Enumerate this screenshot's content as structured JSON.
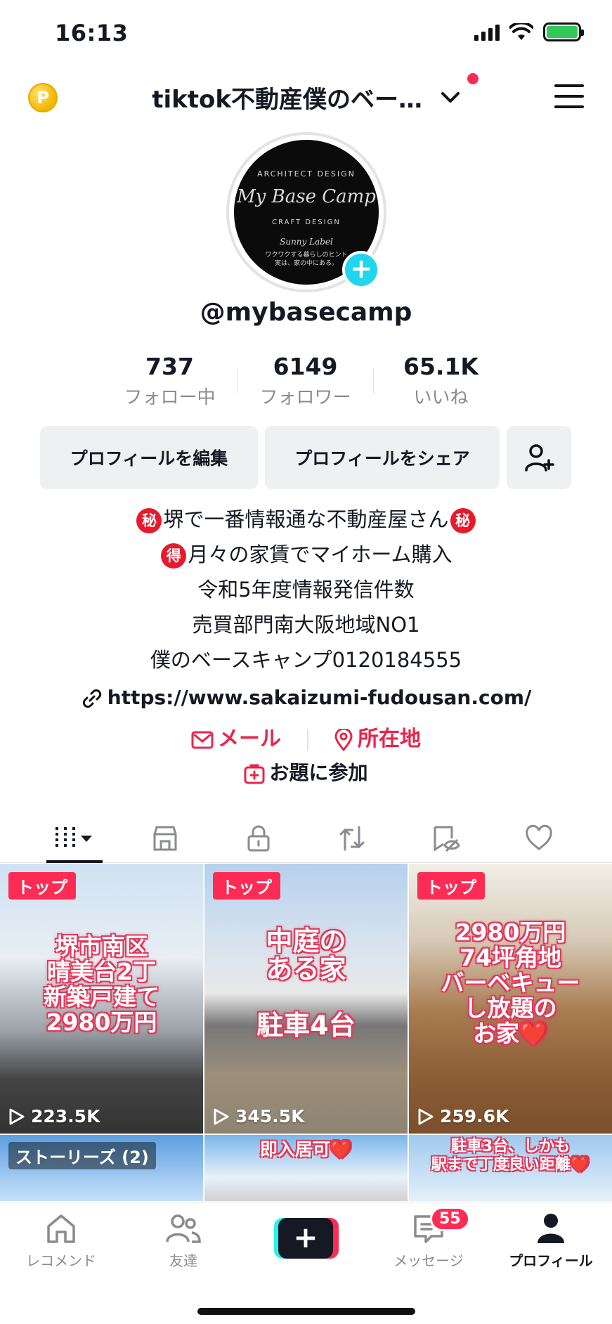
{
  "status_bar": {
    "time": "16:13"
  },
  "header": {
    "account_name": "tiktok不動産僕のベー…",
    "coin_label": "P"
  },
  "profile": {
    "avatar": {
      "line1": "ARCHITECT DESIGN",
      "line2": "My Base Camp",
      "line3": "CRAFT DESIGN",
      "line4": "Sunny Label",
      "line5": "ワクワクする暮らしのヒント\n実は、家の中にある。"
    },
    "username": "@mybasecamp",
    "stats": [
      {
        "value": "737",
        "label": "フォロー中"
      },
      {
        "value": "6149",
        "label": "フォロワー"
      },
      {
        "value": "65.1K",
        "label": "いいね"
      }
    ],
    "buttons": {
      "edit": "プロフィールを編集",
      "share": "プロフィールをシェア"
    },
    "bio": {
      "line1_badge": "秘",
      "line1_text": "堺で一番情報通な不動産屋さん",
      "line2_badge": "得",
      "line2_text": "月々の家賃でマイホーム購入",
      "line3": "令和5年度情報発信件数",
      "line4": "売買部門南大阪地域NO1",
      "line5": "僕のベースキャンプ0120184555"
    },
    "link": "https://www.sakaizumi-fudousan.com/",
    "contacts": {
      "mail": "メール",
      "location": "所在地"
    },
    "topic": "お題に参加"
  },
  "videos": [
    {
      "pin": "トップ",
      "overlay": "堺市南区\n晴美台2丁\n新築戸建て\n2980万円",
      "views": "223.5K"
    },
    {
      "pin": "トップ",
      "overlay": "中庭の\nある家\n\n駐車4台",
      "views": "345.5K"
    },
    {
      "pin": "トップ",
      "overlay": "2980万円\n74坪角地\nバーベキュー\nし放題の\nお家❤️",
      "views": "259.6K"
    },
    {
      "stories": "ストーリーズ (2)"
    },
    {
      "caption": "即入居可❤️"
    },
    {
      "caption": "駐車3台、しかも\n駅まで丁度良い距離❤️"
    }
  ],
  "bottom_nav": {
    "home": "レコメンド",
    "friends": "友達",
    "create": "+",
    "inbox": "メッセージ",
    "inbox_badge": "55",
    "profile": "プロフィール"
  },
  "colors": {
    "accent": "#fe2c55",
    "cyan": "#25f4ee",
    "contact_red": "#e6264c",
    "muted": "#8a8b91"
  }
}
